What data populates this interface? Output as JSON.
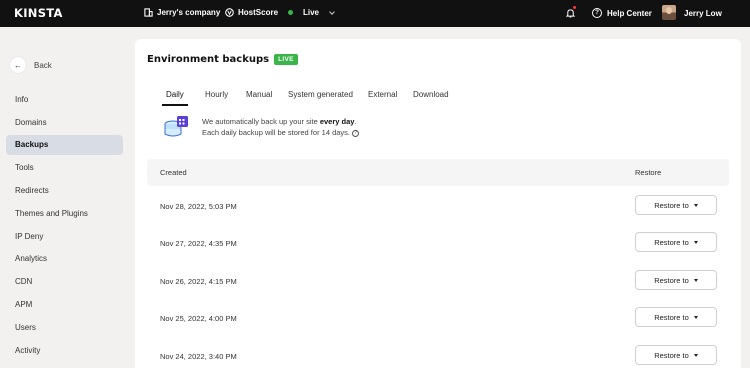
{
  "topbar": {
    "brand": "KINSTA",
    "company": "Jerry's company",
    "hostscore": "HostScore",
    "environment": "Live",
    "help": "Help Center",
    "user": "Jerry Low",
    "icons": [
      "building-icon",
      "hostscore-icon",
      "bell-icon",
      "help-icon",
      "avatar"
    ],
    "live_color": "#3ab54a"
  },
  "sidebar": {
    "back": "Back",
    "items": [
      {
        "label": "Info"
      },
      {
        "label": "Domains"
      },
      {
        "label": "Backups",
        "active": true
      },
      {
        "label": "Tools"
      },
      {
        "label": "Redirects"
      },
      {
        "label": "Themes and Plugins"
      },
      {
        "label": "IP Deny"
      },
      {
        "label": "Analytics"
      },
      {
        "label": "CDN"
      },
      {
        "label": "APM"
      },
      {
        "label": "Users"
      },
      {
        "label": "Activity"
      }
    ]
  },
  "main": {
    "title": "Environment backups",
    "badge": "LIVE",
    "tabs": [
      {
        "label": "Daily",
        "active": true
      },
      {
        "label": "Hourly"
      },
      {
        "label": "Manual"
      },
      {
        "label": "System generated"
      },
      {
        "label": "External"
      },
      {
        "label": "Download"
      }
    ],
    "info": {
      "line1_prefix": "We automatically back up your site ",
      "line1_bold": "every day",
      "line1_suffix": ".",
      "line2": "Each daily backup will be stored for 14 days."
    },
    "table": {
      "col_created": "Created",
      "col_restore": "Restore",
      "restore_label": "Restore to",
      "rows": [
        {
          "created": "Nov 28, 2022, 5:03 PM"
        },
        {
          "created": "Nov 27, 2022, 4:35 PM"
        },
        {
          "created": "Nov 26, 2022, 4:15 PM"
        },
        {
          "created": "Nov 25, 2022, 4:00 PM"
        },
        {
          "created": "Nov 24, 2022, 3:40 PM"
        }
      ]
    }
  }
}
